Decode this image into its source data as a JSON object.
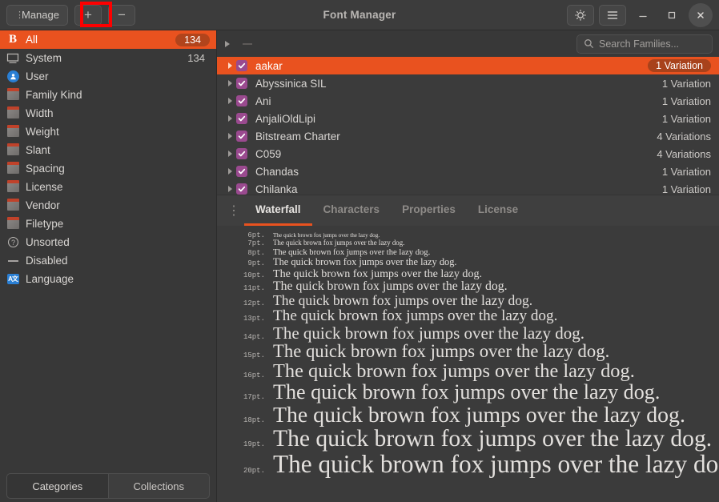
{
  "window": {
    "title": "Font Manager",
    "manage_label": "Manage",
    "add_label": "+",
    "remove_label": "−",
    "minimize_label": "—",
    "maximize_label": "□",
    "close_label": "✕",
    "accent_color": "#e9521f",
    "annotation_color": "#fe0000"
  },
  "sidebar": {
    "items": [
      {
        "label": "All",
        "count": "134",
        "icon": "bold-b-icon",
        "selected": true
      },
      {
        "label": "System",
        "count": "134",
        "icon": "monitor-icon",
        "selected": false
      },
      {
        "label": "User",
        "count": "",
        "icon": "user-icon",
        "selected": false
      },
      {
        "label": "Family Kind",
        "count": "",
        "icon": "folder-icon",
        "selected": false
      },
      {
        "label": "Width",
        "count": "",
        "icon": "folder-icon",
        "selected": false
      },
      {
        "label": "Weight",
        "count": "",
        "icon": "folder-icon",
        "selected": false
      },
      {
        "label": "Slant",
        "count": "",
        "icon": "folder-icon",
        "selected": false
      },
      {
        "label": "Spacing",
        "count": "",
        "icon": "folder-icon",
        "selected": false
      },
      {
        "label": "License",
        "count": "",
        "icon": "folder-icon",
        "selected": false
      },
      {
        "label": "Vendor",
        "count": "",
        "icon": "folder-icon",
        "selected": false
      },
      {
        "label": "Filetype",
        "count": "",
        "icon": "folder-icon",
        "selected": false
      },
      {
        "label": "Unsorted",
        "count": "",
        "icon": "question-icon",
        "selected": false
      },
      {
        "label": "Disabled",
        "count": "",
        "icon": "dash-icon",
        "selected": false
      },
      {
        "label": "Language",
        "count": "",
        "icon": "language-icon",
        "selected": false
      }
    ],
    "tabs": [
      {
        "label": "Categories",
        "active": true
      },
      {
        "label": "Collections",
        "active": false
      }
    ]
  },
  "search": {
    "placeholder": "Search Families...",
    "value": ""
  },
  "font_list": {
    "rows": [
      {
        "name": "aakar",
        "variations": "1 Variation",
        "checked": true,
        "selected": true
      },
      {
        "name": "Abyssinica SIL",
        "variations": "1 Variation",
        "checked": true,
        "selected": false
      },
      {
        "name": "Ani",
        "variations": "1 Variation",
        "checked": true,
        "selected": false
      },
      {
        "name": "AnjaliOldLipi",
        "variations": "1 Variation",
        "checked": true,
        "selected": false
      },
      {
        "name": "Bitstream Charter",
        "variations": "4 Variations",
        "checked": true,
        "selected": false
      },
      {
        "name": "C059",
        "variations": "4 Variations",
        "checked": true,
        "selected": false
      },
      {
        "name": "Chandas",
        "variations": "1 Variation",
        "checked": true,
        "selected": false
      },
      {
        "name": "Chilanka",
        "variations": "1 Variation",
        "checked": true,
        "selected": false
      }
    ]
  },
  "preview": {
    "tabs": [
      {
        "label": "Waterfall",
        "active": true
      },
      {
        "label": "Characters",
        "active": false
      },
      {
        "label": "Properties",
        "active": false
      },
      {
        "label": "License",
        "active": false
      }
    ],
    "pangram": "The quick brown fox jumps over the lazy dog.",
    "sizes": [
      "6pt.",
      "7pt.",
      "8pt.",
      "9pt.",
      "10pt.",
      "11pt.",
      "12pt.",
      "13pt.",
      "14pt.",
      "15pt.",
      "16pt.",
      "17pt.",
      "18pt.",
      "19pt.",
      "20pt."
    ]
  }
}
